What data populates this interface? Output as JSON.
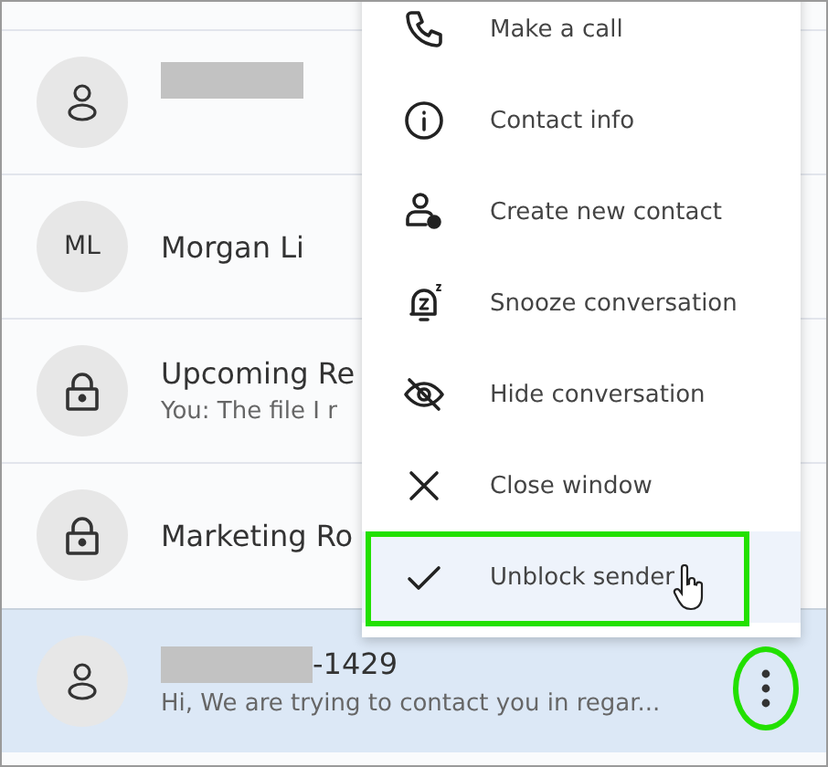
{
  "conversations": [
    {
      "avatar": {
        "kind": "person"
      },
      "redacted": true,
      "selected": false
    },
    {
      "avatar": {
        "kind": "initials",
        "text": "ML"
      },
      "title": "Morgan Li",
      "selected": false
    },
    {
      "avatar": {
        "kind": "lock"
      },
      "title": "Upcoming Re",
      "preview": "You: The file I r",
      "selected": false
    },
    {
      "avatar": {
        "kind": "lock"
      },
      "title": "Marketing Ro",
      "selected": false
    },
    {
      "avatar": {
        "kind": "person"
      },
      "redacted": true,
      "title": "-1429",
      "preview": "Hi, We are trying to contact you in regar...",
      "selected": true
    }
  ],
  "more_button": {
    "circled": true
  },
  "menu": [
    {
      "kind": "phone",
      "label": "Make a call",
      "highlighted": false
    },
    {
      "kind": "info",
      "label": "Contact info",
      "highlighted": false
    },
    {
      "kind": "add-contact",
      "label": "Create new contact",
      "highlighted": false
    },
    {
      "kind": "snooze",
      "label": "Snooze conversation",
      "highlighted": false
    },
    {
      "kind": "hide",
      "label": "Hide conversation",
      "highlighted": false
    },
    {
      "kind": "close",
      "label": "Close window",
      "highlighted": false
    },
    {
      "kind": "check",
      "label": "Unblock sender",
      "highlighted": true
    }
  ]
}
